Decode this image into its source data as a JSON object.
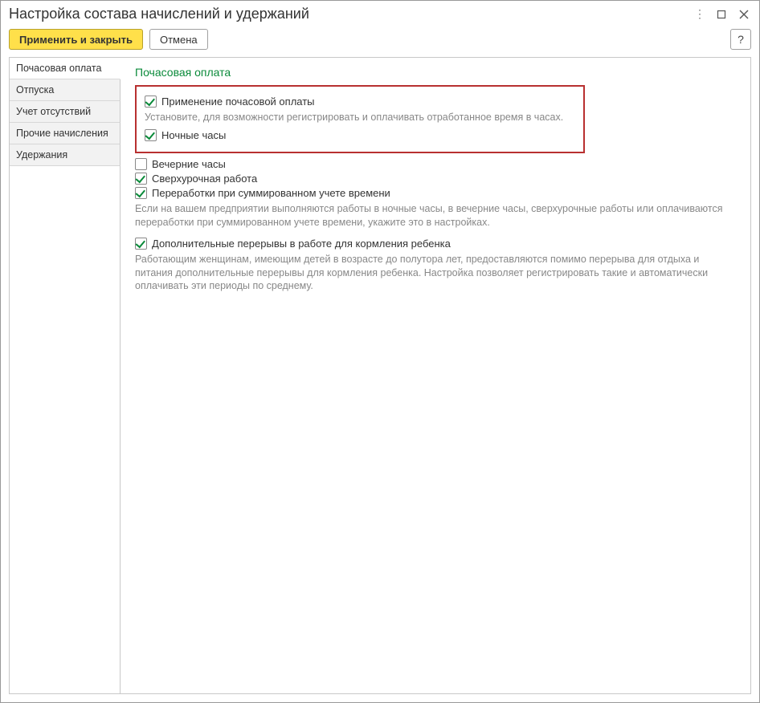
{
  "window": {
    "title": "Настройка состава начислений и удержаний"
  },
  "toolbar": {
    "apply_close": "Применить и закрыть",
    "cancel": "Отмена",
    "help": "?"
  },
  "sidebar": {
    "items": [
      {
        "label": "Почасовая оплата",
        "active": true
      },
      {
        "label": "Отпуска",
        "active": false
      },
      {
        "label": "Учет отсутствий",
        "active": false
      },
      {
        "label": "Прочие начисления",
        "active": false
      },
      {
        "label": "Удержания",
        "active": false
      }
    ]
  },
  "content": {
    "title": "Почасовая оплата",
    "hourly_pay": {
      "label": "Применение почасовой оплаты",
      "checked": true
    },
    "hourly_pay_hint": "Установите, для возможности регистрировать и оплачивать отработанное время в часах.",
    "night_hours": {
      "label": "Ночные часы",
      "checked": true
    },
    "evening_hours": {
      "label": "Вечерние часы",
      "checked": false
    },
    "overtime_work": {
      "label": "Сверхурочная работа",
      "checked": true
    },
    "overwork_summarized": {
      "label": "Переработки при суммированном учете времени",
      "checked": true
    },
    "hours_hint": "Если на вашем предприятии выполняются работы в ночные часы, в вечерние часы, сверхурочные работы или оплачиваются переработки при суммированном учете времени, укажите это в настройках.",
    "feeding_breaks": {
      "label": "Дополнительные перерывы в работе для кормления ребенка",
      "checked": true
    },
    "feeding_hint": "Работающим женщинам, имеющим детей в возрасте до полутора лет, предоставляются помимо перерыва для отдыха и питания дополнительные перерывы для кормления ребенка. Настройка позволяет регистрировать такие и автоматически оплачивать эти периоды по среднему."
  }
}
